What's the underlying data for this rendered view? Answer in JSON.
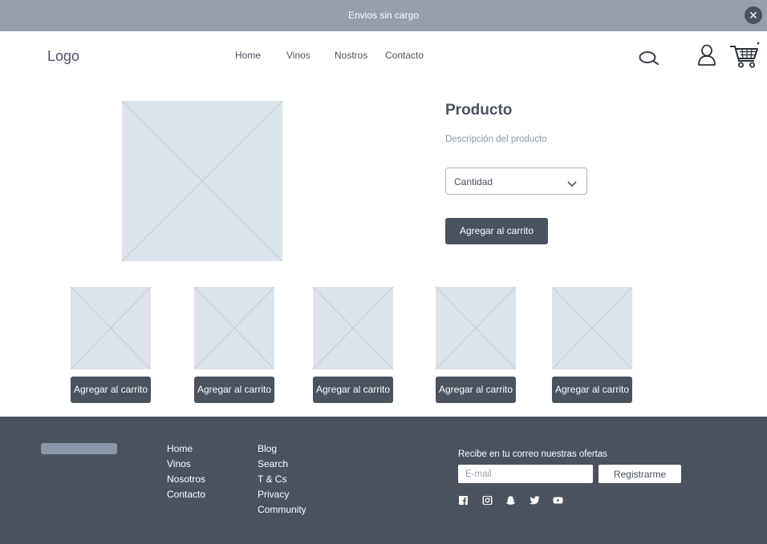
{
  "announcement": {
    "text": "Envios sin cargo",
    "close_icon": "close-icon"
  },
  "header": {
    "logo": "Logo",
    "nav": [
      "Home",
      "Vinos",
      "Nostros",
      "Contacto"
    ],
    "icons": [
      "search-icon",
      "user-icon",
      "cart-icon"
    ]
  },
  "product": {
    "title": "Producto",
    "description": "Descripción del producto",
    "quantity_label": "Cantidad",
    "add_to_cart": "Agregar al carrito"
  },
  "related": {
    "items": [
      {
        "button": "Agregar al carrito"
      },
      {
        "button": "Agregar al carrito"
      },
      {
        "button": "Agregar al carrito"
      },
      {
        "button": "Agregar al carrito"
      },
      {
        "button": "Agregar al carrito"
      }
    ]
  },
  "footer": {
    "col1": [
      "Home",
      "Vinos",
      "Nosotros",
      "Contacto"
    ],
    "col2": [
      "Blog",
      "Search",
      "T & Cs",
      "Privacy",
      "Community"
    ],
    "newsletter_label": "Recibe en tu correo nuestras ofertas",
    "email_placeholder": "E-mail",
    "register_button": "Registrarme",
    "social_icons": [
      "facebook-icon",
      "instagram-icon",
      "snapchat-icon",
      "twitter-icon",
      "youtube-icon"
    ]
  },
  "colors": {
    "dark": "#4a5260",
    "bar": "#979fac",
    "placeholder": "#dde3ec",
    "muted": "#8a97aa"
  }
}
